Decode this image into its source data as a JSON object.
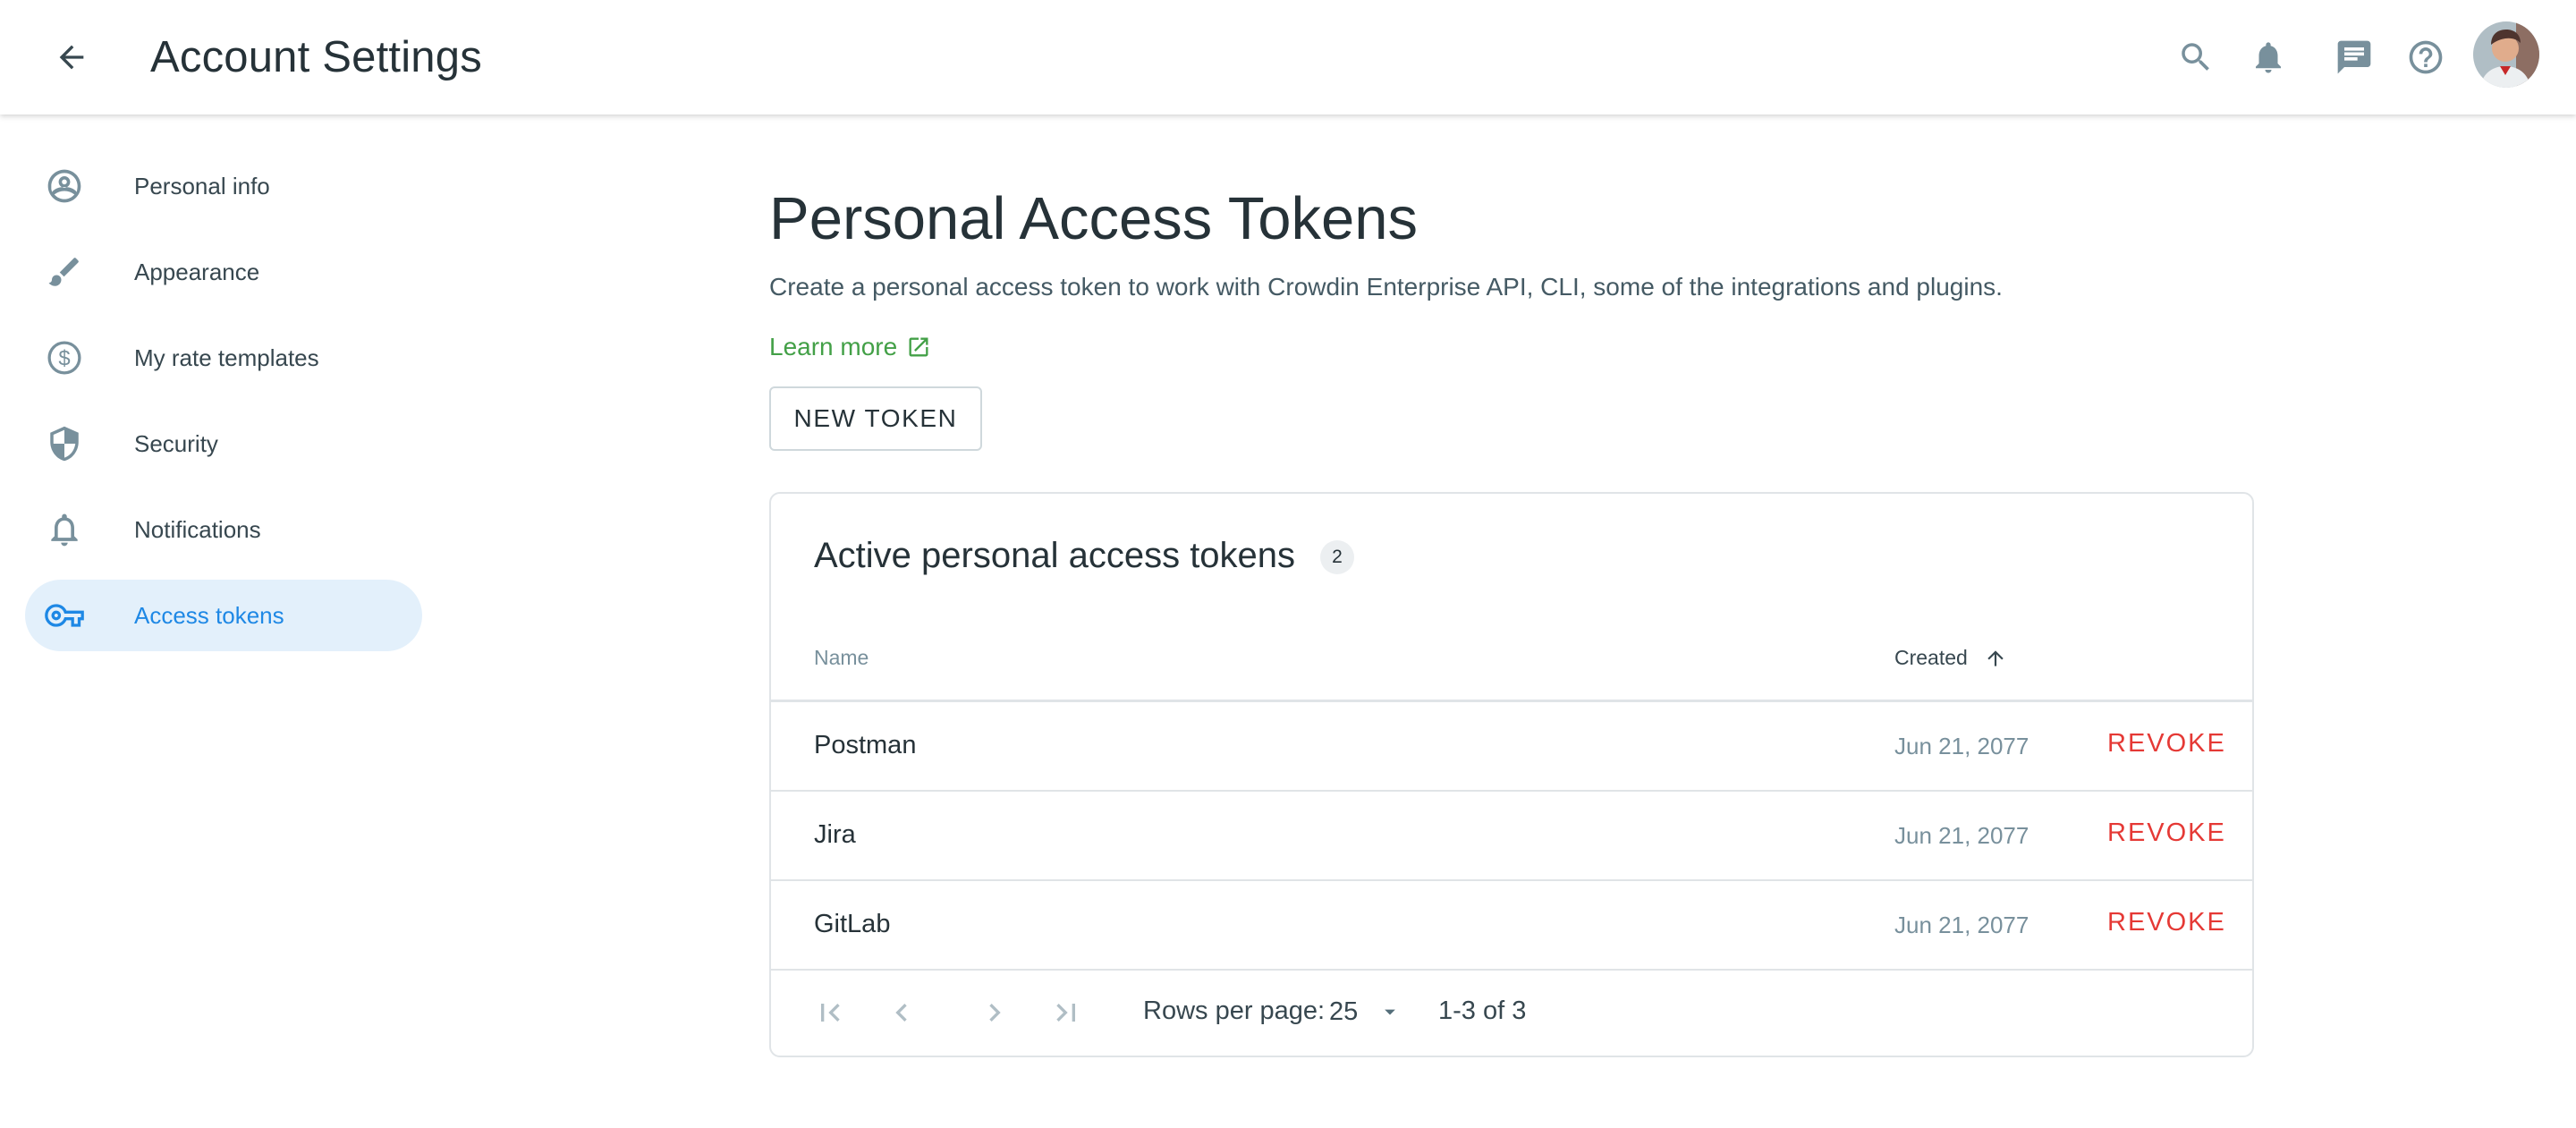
{
  "header": {
    "title": "Account Settings",
    "icons": [
      "back-arrow-icon",
      "search-icon",
      "bell-icon",
      "chat-icon",
      "help-icon",
      "avatar"
    ]
  },
  "sidebar": {
    "items": [
      {
        "label": "Personal info",
        "icon": "account-circle-icon",
        "active": false
      },
      {
        "label": "Appearance",
        "icon": "brush-icon",
        "active": false
      },
      {
        "label": "My rate templates",
        "icon": "dollar-circle-icon",
        "active": false
      },
      {
        "label": "Security",
        "icon": "shield-icon",
        "active": false
      },
      {
        "label": "Notifications",
        "icon": "bell-outline-icon",
        "active": false
      },
      {
        "label": "Access tokens",
        "icon": "key-icon",
        "active": true
      }
    ]
  },
  "main": {
    "title": "Personal Access Tokens",
    "description": "Create a personal access token to work with Crowdin Enterprise API, CLI, some of the integrations and plugins.",
    "learn_more": "Learn more",
    "new_token_label": "NEW TOKEN",
    "card": {
      "title": "Active personal access tokens",
      "count": "2",
      "columns": {
        "name": "Name",
        "created": "Created"
      },
      "rows": [
        {
          "name": "Postman",
          "created": "Jun 21, 2077",
          "action": "REVOKE"
        },
        {
          "name": "Jira",
          "created": "Jun 21, 2077",
          "action": "REVOKE"
        },
        {
          "name": "GitLab",
          "created": "Jun 21, 2077",
          "action": "REVOKE"
        }
      ],
      "pagination": {
        "rows_per_page_label": "Rows per page:",
        "rows_per_page_value": "25",
        "range": "1-3 of 3"
      }
    }
  },
  "colors": {
    "accent": "#1e88e5",
    "active_bg": "#e3f0fb",
    "link_green": "#43a047",
    "danger_red": "#e53935",
    "text_dark": "#263238"
  }
}
